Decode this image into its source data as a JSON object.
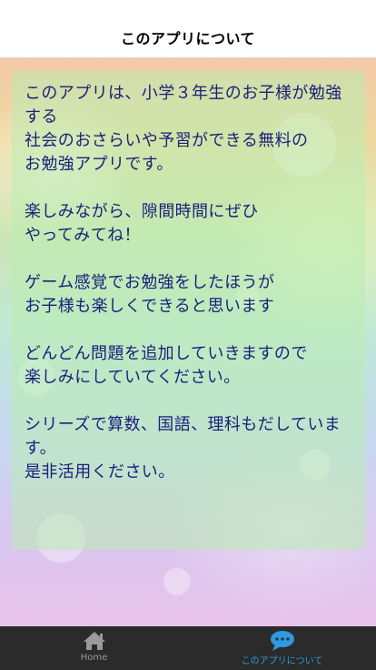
{
  "header": {
    "title": "このアプリについて"
  },
  "content": {
    "paragraphs": [
      "このアプリは、小学３年生のお子様が勉強する\n社会のおさらいや予習ができる無料の\nお勉強アプリです。",
      "楽しみながら、隙間時間にぜひ\nやってみてね！",
      "ゲーム感覚でお勉強をしたほうが\nお子様も楽しくできると思います",
      "どんどん問題を追加していきますので\n楽しみにしていてください。",
      "シリーズで算数、国語、理科もだしています。\n是非活用ください。"
    ]
  },
  "tabbar": {
    "tabs": [
      {
        "label": "Home",
        "icon": "home-icon",
        "active": false
      },
      {
        "label": "このアプリについて",
        "icon": "speech-bubble-icon",
        "active": true
      }
    ],
    "colors": {
      "active": "#2c9be0",
      "inactive": "#9a9a9a",
      "background": "#2b2b2b"
    }
  }
}
